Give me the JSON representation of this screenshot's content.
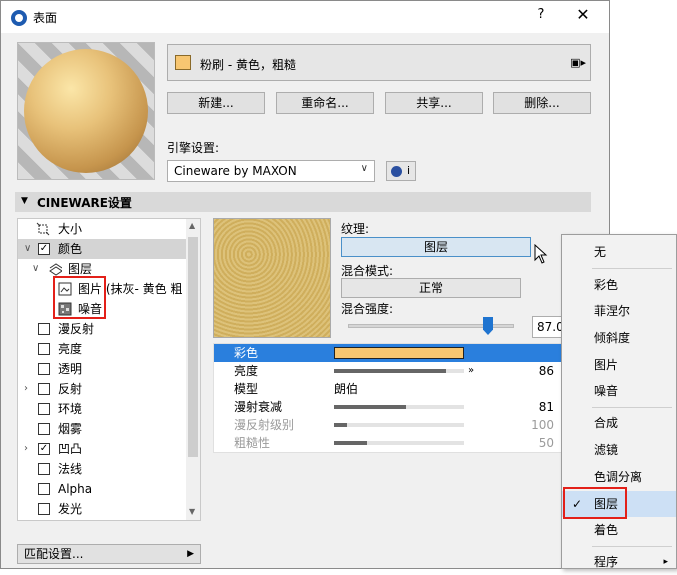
{
  "window": {
    "title": "表面",
    "help": "?",
    "close": "✕"
  },
  "material": {
    "name": "粉刷 - 黄色，粗糙",
    "swatch_color": "#f7c671"
  },
  "buttons": {
    "new": "新建...",
    "rename": "重命名...",
    "share": "共享...",
    "delete": "删除..."
  },
  "engine": {
    "label": "引擎设置:",
    "value": "Cineware by MAXON",
    "info_icon": "i"
  },
  "section": {
    "title": "CINEWARE设置"
  },
  "channels": [
    {
      "label": "大小",
      "icon": "size-icon"
    },
    {
      "label": "颜色",
      "checked": "✓",
      "expand": "∨"
    },
    {
      "label": "图层",
      "icon": "layers-icon",
      "expand": "∨"
    },
    {
      "label": "图片 (抹灰- 黄色 粗",
      "icon": "image-icon"
    },
    {
      "label": "噪音",
      "icon": "noise-icon"
    },
    {
      "label": "漫反射"
    },
    {
      "label": "亮度"
    },
    {
      "label": "透明"
    },
    {
      "label": "反射",
      "expand": "›"
    },
    {
      "label": "环境"
    },
    {
      "label": "烟雾"
    },
    {
      "label": "凹凸",
      "checked": "✓",
      "expand": "›"
    },
    {
      "label": "法线"
    },
    {
      "label": "Alpha"
    },
    {
      "label": "发光"
    }
  ],
  "match_button": "匹配设置...",
  "texture": {
    "label": "纹理:",
    "button": "图层",
    "blend_label": "混合模式:",
    "blend_value": "正常",
    "strength_label": "混合强度:",
    "strength_value": "87.00",
    "strength_fraction": 0.87
  },
  "properties": [
    {
      "label": "彩色",
      "type": "color"
    },
    {
      "label": "亮度",
      "value": "86",
      "fraction": 0.86
    },
    {
      "label": "模型",
      "value": "朗伯"
    },
    {
      "label": "漫射衰减",
      "value": "81",
      "fraction": 0.55
    },
    {
      "label": "漫反射级别",
      "value": "100",
      "fraction": 0.1
    },
    {
      "label": "粗糙性",
      "value": "50",
      "fraction": 0.25
    }
  ],
  "popup_menu": [
    "无",
    "彩色",
    "菲涅尔",
    "倾斜度",
    "图片",
    "噪音",
    "合成",
    "滤镜",
    "色调分离",
    "图层",
    "着色",
    "程序"
  ],
  "popup_checked": "✓",
  "popup_submenu": "▸",
  "colors": {
    "accent": "#2a7fdd",
    "highlight_red": "#e32019",
    "swatch": "#f7c671"
  }
}
